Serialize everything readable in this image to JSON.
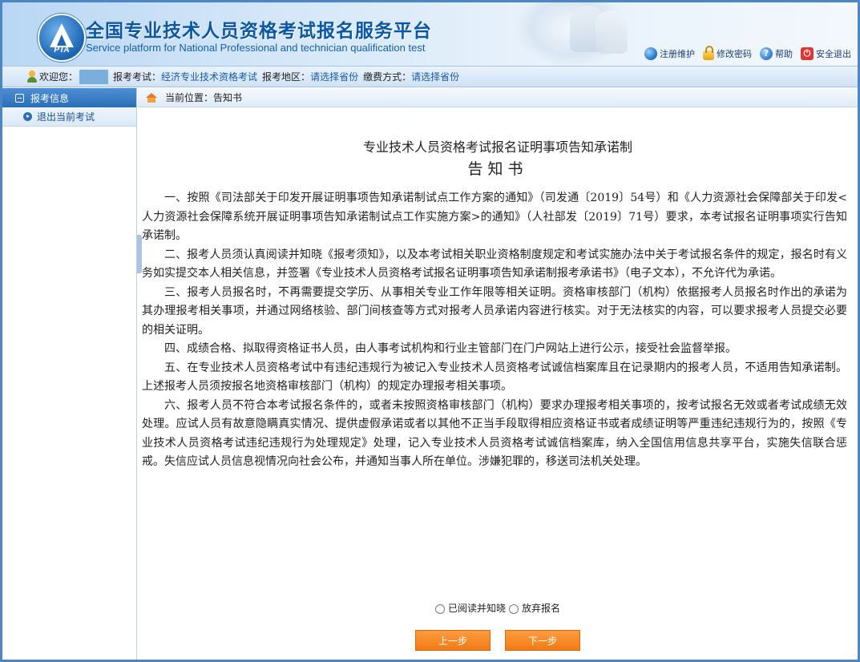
{
  "header": {
    "logo_text": "PTA",
    "title": "全国专业技术人员资格考试报名服务平台",
    "subtitle": "Service platform for National Professional and technician qualification test",
    "links": [
      {
        "label": "注册维护",
        "icon": "globe-icon"
      },
      {
        "label": "修改密码",
        "icon": "lock-icon"
      },
      {
        "label": "帮助",
        "icon": "help-icon"
      },
      {
        "label": "安全退出",
        "icon": "power-icon"
      }
    ]
  },
  "infobar": {
    "welcome": "欢迎您：",
    "exam_label": "报考考试：",
    "exam_value": "经济专业技术资格考试",
    "region_label": "报考地区：",
    "region_value": "请选择省份",
    "pay_label": "缴费方式：",
    "pay_value": "请选择省份"
  },
  "sidebar": {
    "header": "报考信息",
    "items": [
      {
        "label": "退出当前考试"
      }
    ]
  },
  "breadcrumb": {
    "label": "当前位置：",
    "current": "告知书"
  },
  "document": {
    "title": "专业技术人员资格考试报名证明事项告知承诺制",
    "subtitle": "告知书",
    "paragraphs": [
      "一、按照《司法部关于印发开展证明事项告知承诺制试点工作方案的通知》（司发通〔2019〕54号）和《人力资源社会保障部关于印发<人力资源社会保障系统开展证明事项告知承诺制试点工作实施方案>的通知》（人社部发〔2019〕71号）要求，本考试报名证明事项实行告知承诺制。",
      "二、报考人员须认真阅读并知晓《报考须知》，以及本考试相关职业资格制度规定和考试实施办法中关于考试报名条件的规定，报名时有义务如实提交本人相关信息，并签署《专业技术人员资格考试报名证明事项告知承诺制报考承诺书》（电子文本），不允许代为承诺。",
      "三、报考人员报名时，不再需要提交学历、从事相关专业工作年限等相关证明。资格审核部门（机构）依据报考人员报名时作出的承诺为其办理报考相关事项，并通过网络核验、部门间核查等方式对报考人员承诺内容进行核实。对于无法核实的内容，可以要求报考人员提交必要的相关证明。",
      "四、成绩合格、拟取得资格证书人员，由人事考试机构和行业主管部门在门户网站上进行公示，接受社会监督举报。",
      "五、在专业技术人员资格考试中有违纪违规行为被记入专业技术人员资格考试诚信档案库且在记录期内的报考人员，不适用告知承诺制。上述报考人员须按报名地资格审核部门（机构）的规定办理报考相关事项。",
      "六、报考人员不符合本考试报名条件的，或者未按照资格审核部门（机构）要求办理报考相关事项的，按考试报名无效或者考试成绩无效处理。应试人员有故意隐瞒真实情况、提供虚假承诺或者以其他不正当手段取得相应资格证书或者成绩证明等严重违纪违规行为的，按照《专业技术人员资格考试违纪违规行为处理规定》处理，记入专业技术人员资格考试诚信档案库，纳入全国信用信息共享平台，实施失信联合惩戒。失信应试人员信息视情况向社会公布，并通知当事人所在单位。涉嫌犯罪的，移送司法机关处理。"
    ]
  },
  "options": {
    "read_label": "已阅读并知晓",
    "abandon_label": "放弃报名"
  },
  "buttons": {
    "prev": "上一步",
    "next": "下一步"
  },
  "colors": {
    "brand_blue": "#0b57a4",
    "button_orange": "#f07a16",
    "sidebar_header": "#2b6eb8"
  }
}
